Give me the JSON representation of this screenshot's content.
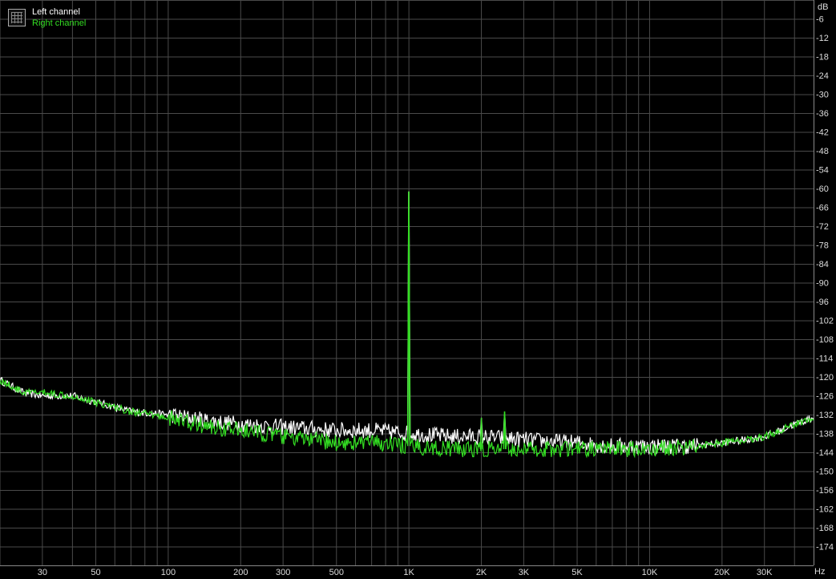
{
  "chart_data": {
    "type": "line",
    "xscale": "log",
    "xlim": [
      20,
      48000
    ],
    "ylim": [
      -180,
      0
    ],
    "xlabel": "Hz",
    "ylabel": "dB",
    "grid": true,
    "legend_position": "top-left",
    "xticks": [
      {
        "value": 30,
        "label": "30"
      },
      {
        "value": 50,
        "label": "50"
      },
      {
        "value": 100,
        "label": "100"
      },
      {
        "value": 200,
        "label": "200"
      },
      {
        "value": 300,
        "label": "300"
      },
      {
        "value": 500,
        "label": "500"
      },
      {
        "value": 1000,
        "label": "1K"
      },
      {
        "value": 2000,
        "label": "2K"
      },
      {
        "value": 3000,
        "label": "3K"
      },
      {
        "value": 5000,
        "label": "5K"
      },
      {
        "value": 10000,
        "label": "10K"
      },
      {
        "value": 20000,
        "label": "20K"
      },
      {
        "value": 30000,
        "label": "30K"
      }
    ],
    "yticks": [
      -6,
      -12,
      -18,
      -24,
      -30,
      -36,
      -42,
      -48,
      -54,
      -60,
      -66,
      -72,
      -78,
      -84,
      -90,
      -96,
      -102,
      -108,
      -114,
      -120,
      -126,
      -132,
      -138,
      -144,
      -150,
      -156,
      -162,
      -168,
      -174
    ],
    "series": [
      {
        "name": "Left channel",
        "color": "#ffffff",
        "points": [
          [
            20,
            -121
          ],
          [
            25,
            -125
          ],
          [
            30,
            -126
          ],
          [
            40,
            -126
          ],
          [
            50,
            -128
          ],
          [
            70,
            -131
          ],
          [
            100,
            -132
          ],
          [
            150,
            -134
          ],
          [
            200,
            -135
          ],
          [
            300,
            -136
          ],
          [
            500,
            -137
          ],
          [
            700,
            -137
          ],
          [
            1000,
            -138
          ],
          [
            1500,
            -139
          ],
          [
            2000,
            -139
          ],
          [
            3000,
            -140
          ],
          [
            5000,
            -141
          ],
          [
            7000,
            -142
          ],
          [
            10000,
            -142
          ],
          [
            15000,
            -142
          ],
          [
            20000,
            -141
          ],
          [
            25000,
            -140
          ],
          [
            30000,
            -139
          ],
          [
            35000,
            -137
          ],
          [
            40000,
            -135
          ],
          [
            48000,
            -133
          ]
        ],
        "peaks": [
          [
            1000,
            -61
          ],
          [
            2000,
            -133
          ],
          [
            2500,
            -132
          ]
        ]
      },
      {
        "name": "Right channel",
        "color": "#33dd22",
        "points": [
          [
            20,
            -121
          ],
          [
            25,
            -125
          ],
          [
            30,
            -125
          ],
          [
            40,
            -126
          ],
          [
            50,
            -128
          ],
          [
            70,
            -131
          ],
          [
            100,
            -133
          ],
          [
            150,
            -136
          ],
          [
            200,
            -137
          ],
          [
            300,
            -139
          ],
          [
            500,
            -141
          ],
          [
            700,
            -141
          ],
          [
            1000,
            -142
          ],
          [
            1500,
            -143
          ],
          [
            2000,
            -143
          ],
          [
            3000,
            -143
          ],
          [
            5000,
            -143
          ],
          [
            7000,
            -143
          ],
          [
            10000,
            -143
          ],
          [
            15000,
            -142
          ],
          [
            20000,
            -141
          ],
          [
            25000,
            -140
          ],
          [
            30000,
            -139
          ],
          [
            35000,
            -137
          ],
          [
            40000,
            -135
          ],
          [
            48000,
            -133
          ]
        ],
        "peaks": [
          [
            1000,
            -61
          ],
          [
            2000,
            -133
          ],
          [
            2500,
            -131
          ]
        ]
      }
    ]
  }
}
